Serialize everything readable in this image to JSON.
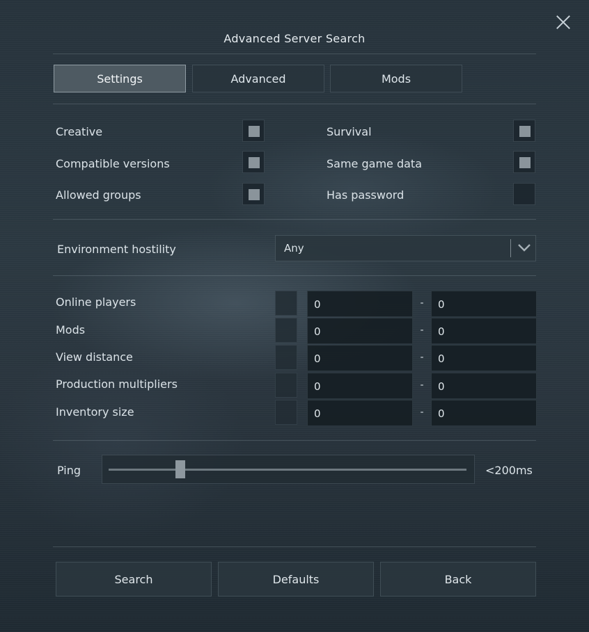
{
  "dialog": {
    "title": "Advanced Server Search",
    "close_icon": "close-icon"
  },
  "tabs": [
    {
      "label": "Settings",
      "active": true
    },
    {
      "label": "Advanced",
      "active": false
    },
    {
      "label": "Mods",
      "active": false
    }
  ],
  "checkboxes": {
    "creative": {
      "label": "Creative",
      "checked": true
    },
    "compatible_versions": {
      "label": "Compatible versions",
      "checked": true
    },
    "allowed_groups": {
      "label": "Allowed groups",
      "checked": true
    },
    "survival": {
      "label": "Survival",
      "checked": true
    },
    "same_game_data": {
      "label": "Same game data",
      "checked": true
    },
    "has_password": {
      "label": "Has password",
      "checked": false
    }
  },
  "environment": {
    "label": "Environment hostility",
    "value": "Any",
    "icon": "chevron-down-icon"
  },
  "ranges": [
    {
      "label": "Online players",
      "min": "0",
      "max": "0",
      "separator": "-"
    },
    {
      "label": "Mods",
      "min": "0",
      "max": "0",
      "separator": "-"
    },
    {
      "label": "View distance",
      "min": "0",
      "max": "0",
      "separator": "-"
    },
    {
      "label": "Production multipliers",
      "min": "0",
      "max": "0",
      "separator": "-"
    },
    {
      "label": "Inventory size",
      "min": "0",
      "max": "0",
      "separator": "-"
    }
  ],
  "ping": {
    "label": "Ping",
    "value_text": "<200ms",
    "slider_fraction": 0.2
  },
  "buttons": {
    "search": "Search",
    "defaults": "Defaults",
    "back": "Back"
  }
}
